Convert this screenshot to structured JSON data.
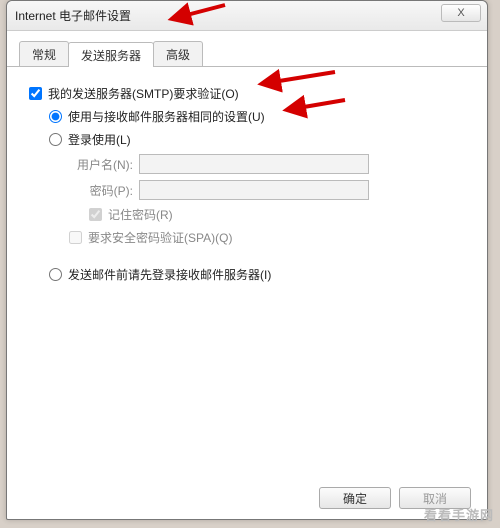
{
  "window": {
    "title": "Internet 电子邮件设置"
  },
  "close_label": "X",
  "tabs": {
    "general": "常规",
    "outgoing": "发送服务器",
    "advanced": "高级"
  },
  "smtp_auth": {
    "label": "我的发送服务器(SMTP)要求验证(O)",
    "opt_same": "使用与接收邮件服务器相同的设置(U)",
    "opt_login": "登录使用(L)",
    "username_label": "用户名(N):",
    "password_label": "密码(P):",
    "remember_pw": "记住密码(R)",
    "require_spa": "要求安全密码验证(SPA)(Q)",
    "opt_login_first": "发送邮件前请先登录接收邮件服务器(I)"
  },
  "buttons": {
    "ok": "确定",
    "cancel": "取消"
  },
  "watermark": "看看手游网"
}
